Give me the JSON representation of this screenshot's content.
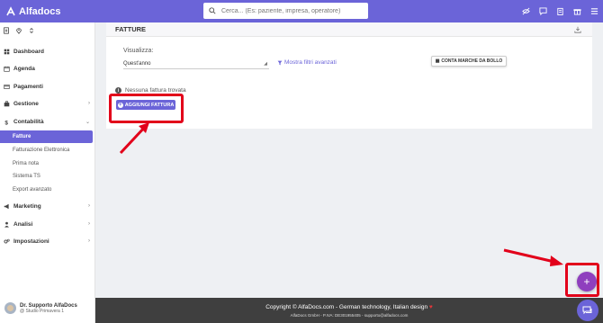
{
  "app": {
    "name": "Alfadocs"
  },
  "search": {
    "placeholder": "Cerca... (Es: paziente, impresa, operatore)"
  },
  "top_icons": [
    "visibility-off-icon",
    "chat-icon",
    "clipboard-icon",
    "gift-icon",
    "menu-icon"
  ],
  "sidebar": {
    "items": [
      {
        "label": "Dashboard",
        "icon": "grid-icon"
      },
      {
        "label": "Agenda",
        "icon": "calendar-icon"
      },
      {
        "label": "Pagamenti",
        "icon": "card-icon"
      },
      {
        "label": "Gestione",
        "icon": "briefcase-icon",
        "chevron": "›"
      },
      {
        "label": "Contabilità",
        "icon": "dollar-icon",
        "chevron": "⌄"
      },
      {
        "label": "Marketing",
        "icon": "megaphone-icon",
        "chevron": "›"
      },
      {
        "label": "Analisi",
        "icon": "person-icon",
        "chevron": "›"
      },
      {
        "label": "Impostazioni",
        "icon": "gears-icon",
        "chevron": "›"
      }
    ],
    "sub_items": [
      {
        "label": "Fatture",
        "active": true
      },
      {
        "label": "Fatturazione Elettronica"
      },
      {
        "label": "Prima nota"
      },
      {
        "label": "Sistema TS"
      },
      {
        "label": "Export avanzato"
      }
    ],
    "user": {
      "name": "Dr. Supporto AlfaDocs",
      "studio": "@ Studio Primavera 1"
    }
  },
  "main": {
    "title": "FATTURE",
    "view_label": "Visualizza:",
    "view_value": "Quest'anno",
    "filters_label": "Mostra filtri avanzati",
    "bollo_button": "CONTA MARCHE DA BOLLO",
    "empty_message": "Nessuna fattura trovata",
    "add_button": "AGGIUNGI FATTURA"
  },
  "fab": {
    "label": "+"
  },
  "footer": {
    "line1": "Copyright © AlfaDocs.com - German technology, Italian design",
    "heart": "♥",
    "line2": "AlfaDocs GmbH - P.IVA: DE301955405 - supporto@alfadocs.com"
  },
  "colors": {
    "primary": "#6b64d8",
    "annotation": "#e2001a",
    "fab": "#8f3fbe",
    "footer": "#3f3f3f"
  }
}
